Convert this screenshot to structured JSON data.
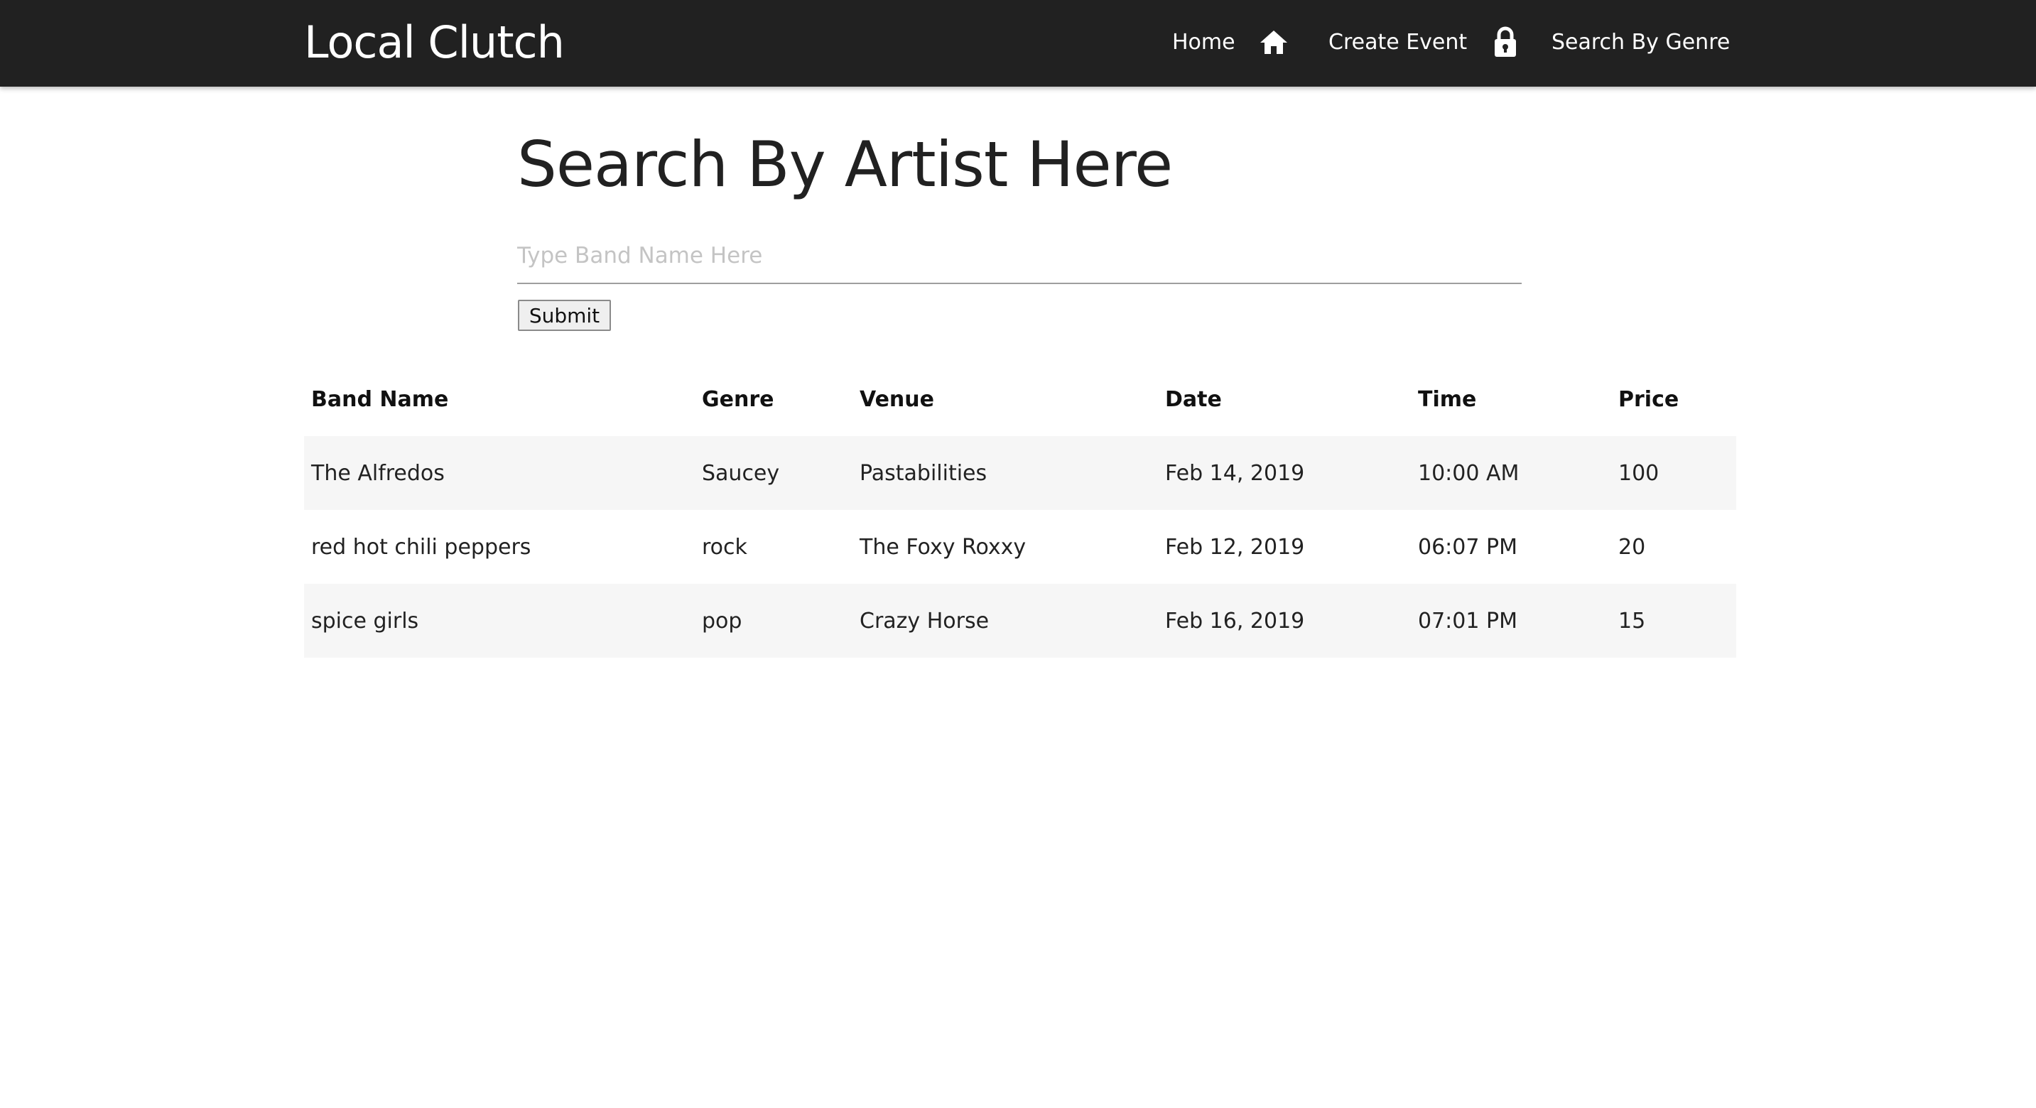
{
  "navbar": {
    "brand": "Local Clutch",
    "items": [
      {
        "label": "Home",
        "icon": "home-icon"
      },
      {
        "label": "Create Event",
        "icon": "lock-icon"
      },
      {
        "label": "Search By Genre"
      }
    ]
  },
  "search": {
    "title": "Search By Artist Here",
    "placeholder": "Type Band Name Here",
    "value": "",
    "submit_label": "Submit"
  },
  "table": {
    "headers": [
      "Band Name",
      "Genre",
      "Venue",
      "Date",
      "Time",
      "Price"
    ],
    "rows": [
      [
        "The Alfredos",
        "Saucey",
        "Pastabilities",
        "Feb 14, 2019",
        "10:00 AM",
        "100"
      ],
      [
        "red hot chili peppers",
        "rock",
        "The Foxy Roxxy",
        "Feb 12, 2019",
        "06:07 PM",
        "20"
      ],
      [
        "spice girls",
        "pop",
        "Crazy Horse",
        "Feb 16, 2019",
        "07:01 PM",
        "15"
      ]
    ]
  },
  "colors": {
    "navbar_background": "#212121",
    "navbar_text": "#ffffff",
    "striped_row": "#f6f6f6",
    "input_underline": "#9e9e9e"
  }
}
